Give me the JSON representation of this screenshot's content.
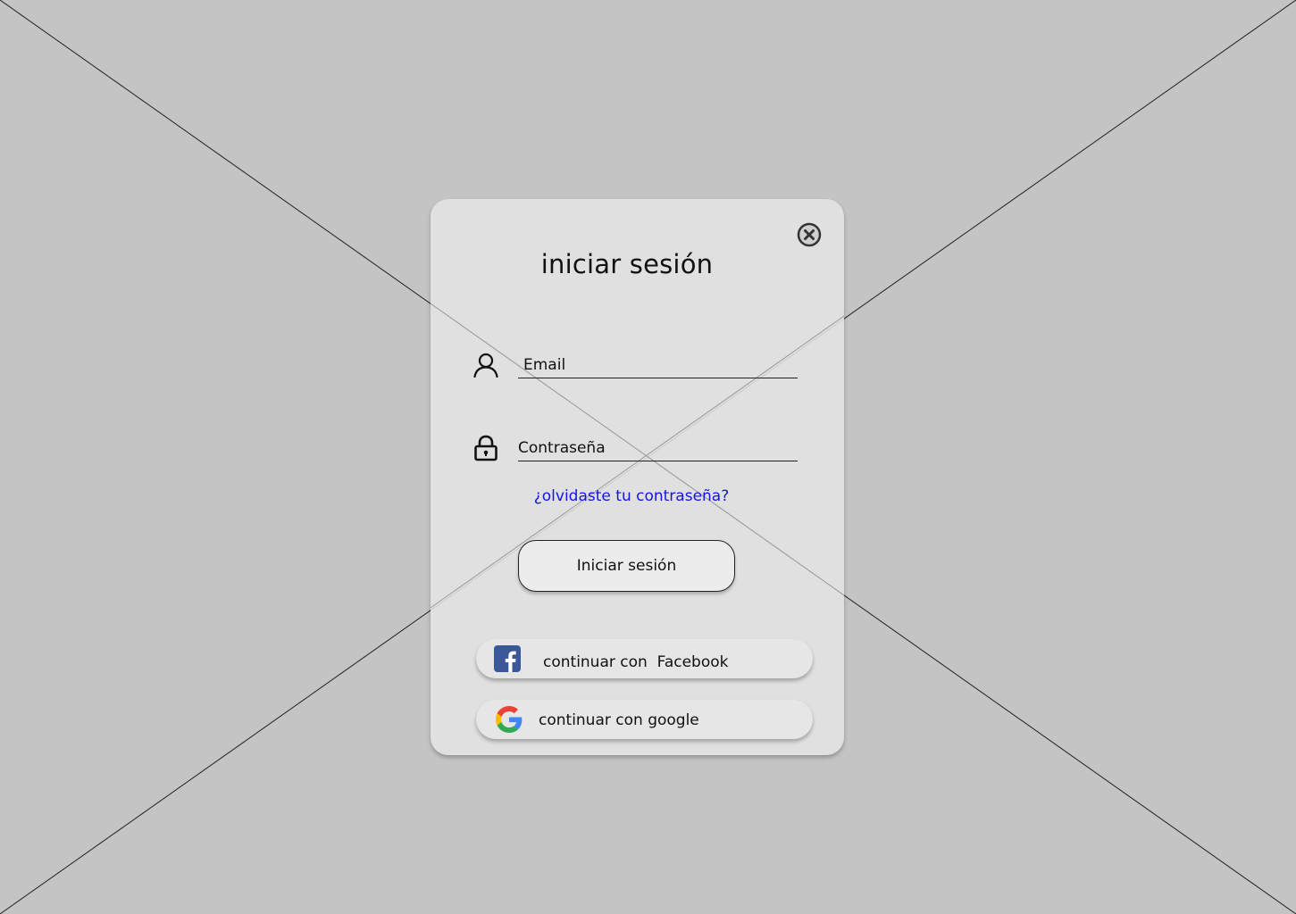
{
  "modal": {
    "title": "iniciar sesión",
    "close_icon": "close-circle-icon",
    "email": {
      "icon": "user-icon",
      "placeholder": "Email",
      "value": ""
    },
    "password": {
      "icon": "lock-icon",
      "placeholder": "Contraseña",
      "value": ""
    },
    "forgot_password_label": "¿olvidaste tu contraseña?",
    "login_button_label": "Iniciar sesión",
    "facebook_button": {
      "icon": "facebook-icon",
      "label": "continuar con  Facebook"
    },
    "google_button": {
      "icon": "google-icon",
      "label": "continuar con google"
    }
  },
  "colors": {
    "background": "#c4c4c4",
    "panel": "#e2e2e2",
    "link": "#1414e8",
    "facebook": "#3b5998",
    "google_blue": "#4285F4",
    "google_red": "#EA4335",
    "google_yellow": "#FBBC05",
    "google_green": "#34A853"
  }
}
